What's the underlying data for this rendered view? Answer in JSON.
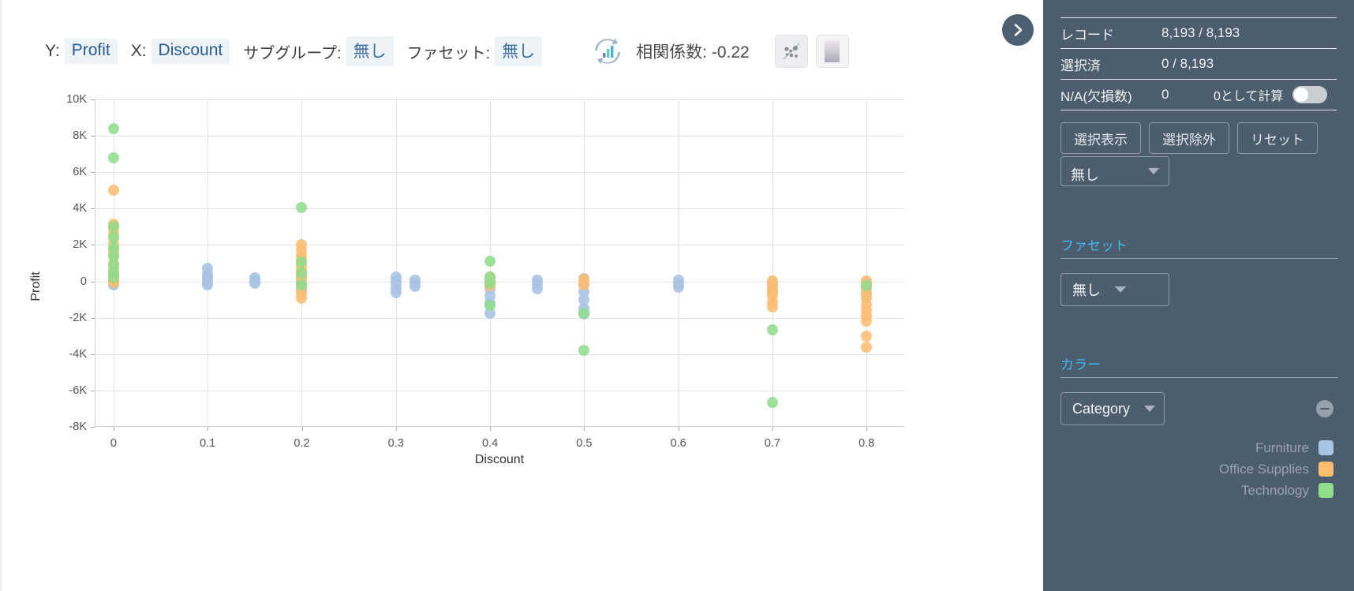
{
  "toolbar": {
    "y_label": "Y:",
    "y_value": "Profit",
    "x_label": "X:",
    "x_value": "Discount",
    "subgroup_label": "サブグループ:",
    "subgroup_value": "無し",
    "facet_label": "ファセット:",
    "facet_value": "無し",
    "correlation_text": "相関係数: -0.22",
    "refresh_icon": "refresh-chart-icon",
    "scatter_mode_icon": "scatter-plot-icon",
    "density_mode_icon": "density-gradient-icon",
    "collapse_icon": "chevron-right-icon"
  },
  "panel": {
    "stats": [
      {
        "key": "レコード",
        "value": "8,193 / 8,193"
      },
      {
        "key": "選択済",
        "value": "0 / 8,193"
      }
    ],
    "na_row": {
      "key": "N/A(欠損数)",
      "count": "0",
      "toggle_label": "0として計算",
      "toggle_on": false
    },
    "buttons": [
      {
        "label": "選択表示",
        "name": "show-selection-button"
      },
      {
        "label": "選択除外",
        "name": "exclude-selection-button"
      },
      {
        "label": "リセット",
        "name": "reset-button"
      }
    ],
    "clipped_select_value": "無し",
    "facet_section": {
      "title": "ファセット",
      "value": "無し"
    },
    "color_section": {
      "title": "カラー",
      "value": "Category",
      "remove_icon": "remove-circle-icon"
    },
    "legend": [
      {
        "label": "Furniture",
        "color": "#a9c3e4"
      },
      {
        "label": "Office Supplies",
        "color": "#fbbd72"
      },
      {
        "label": "Technology",
        "color": "#90dd8c"
      }
    ]
  },
  "chart_data": {
    "type": "scatter",
    "title": "",
    "xlabel": "Discount",
    "ylabel": "Profit",
    "xlim": [
      -0.02,
      0.84
    ],
    "ylim": [
      -8000,
      10000
    ],
    "xticks": [
      "0",
      "0.1",
      "0.2",
      "0.3",
      "0.4",
      "0.5",
      "0.6",
      "0.7",
      "0.8"
    ],
    "xtick_values": [
      0,
      0.1,
      0.2,
      0.3,
      0.4,
      0.5,
      0.6,
      0.7,
      0.8
    ],
    "yticks": [
      "10K",
      "8K",
      "6K",
      "4K",
      "2K",
      "0",
      "-2K",
      "-4K",
      "-6K",
      "-8K"
    ],
    "ytick_values": [
      10000,
      8000,
      6000,
      4000,
      2000,
      0,
      -2000,
      -4000,
      -6000,
      -8000
    ],
    "grid": true,
    "legend_position": "right-panel",
    "correlation": -0.22,
    "color_by": "Category",
    "series": [
      {
        "name": "Furniture",
        "color": "#a9c3e4",
        "points": [
          [
            0,
            500
          ],
          [
            0,
            300
          ],
          [
            0,
            150
          ],
          [
            0,
            60
          ],
          [
            0,
            -40
          ],
          [
            0,
            -120
          ],
          [
            0,
            20
          ],
          [
            0,
            420
          ],
          [
            0,
            240
          ],
          [
            0,
            -200
          ],
          [
            0,
            380
          ],
          [
            0,
            100
          ],
          [
            0.1,
            700
          ],
          [
            0.1,
            400
          ],
          [
            0.1,
            150
          ],
          [
            0.1,
            -50
          ],
          [
            0.1,
            -180
          ],
          [
            0.1,
            260
          ],
          [
            0.15,
            180
          ],
          [
            0.15,
            20
          ],
          [
            0.15,
            -120
          ],
          [
            0.2,
            300
          ],
          [
            0.2,
            60
          ],
          [
            0.2,
            -160
          ],
          [
            0.2,
            -320
          ],
          [
            0.2,
            -500
          ],
          [
            0.2,
            150
          ],
          [
            0.3,
            220
          ],
          [
            0.3,
            30
          ],
          [
            0.3,
            -150
          ],
          [
            0.3,
            -400
          ],
          [
            0.3,
            -620
          ],
          [
            0.32,
            60
          ],
          [
            0.32,
            -120
          ],
          [
            0.32,
            -300
          ],
          [
            0.4,
            200
          ],
          [
            0.4,
            -100
          ],
          [
            0.4,
            -400
          ],
          [
            0.4,
            -800
          ],
          [
            0.4,
            -1200
          ],
          [
            0.4,
            -1750
          ],
          [
            0.45,
            60
          ],
          [
            0.45,
            -160
          ],
          [
            0.45,
            -420
          ],
          [
            0.5,
            150
          ],
          [
            0.5,
            -200
          ],
          [
            0.5,
            -600
          ],
          [
            0.5,
            -1000
          ],
          [
            0.5,
            -1500
          ],
          [
            0.5,
            -1800
          ],
          [
            0.6,
            60
          ],
          [
            0.6,
            -140
          ],
          [
            0.6,
            -330
          ],
          [
            0.7,
            -100
          ],
          [
            0.7,
            -300
          ],
          [
            0.7,
            -550
          ],
          [
            0.8,
            -120
          ],
          [
            0.8,
            -380
          ],
          [
            0.8,
            -700
          ]
        ]
      },
      {
        "name": "Office Supplies",
        "color": "#fbbd72",
        "points": [
          [
            0,
            5000
          ],
          [
            0,
            3150
          ],
          [
            0,
            2600
          ],
          [
            0,
            2050
          ],
          [
            0,
            1450
          ],
          [
            0,
            1000
          ],
          [
            0,
            700
          ],
          [
            0,
            420
          ],
          [
            0,
            200
          ],
          [
            0,
            60
          ],
          [
            0,
            -80
          ],
          [
            0,
            2900
          ],
          [
            0,
            1700
          ],
          [
            0.2,
            2020
          ],
          [
            0.2,
            1700
          ],
          [
            0.2,
            1400
          ],
          [
            0.2,
            1150
          ],
          [
            0.2,
            900
          ],
          [
            0.2,
            650
          ],
          [
            0.2,
            380
          ],
          [
            0.2,
            120
          ],
          [
            0.2,
            -300
          ],
          [
            0.2,
            -650
          ],
          [
            0.2,
            -950
          ],
          [
            0.4,
            260
          ],
          [
            0.4,
            40
          ],
          [
            0.4,
            -220
          ],
          [
            0.5,
            120
          ],
          [
            0.5,
            -180
          ],
          [
            0.7,
            40
          ],
          [
            0.7,
            -220
          ],
          [
            0.7,
            -520
          ],
          [
            0.7,
            -800
          ],
          [
            0.7,
            -1150
          ],
          [
            0.7,
            -1420
          ],
          [
            0.8,
            10
          ],
          [
            0.8,
            -300
          ],
          [
            0.8,
            -620
          ],
          [
            0.8,
            -950
          ],
          [
            0.8,
            -1280
          ],
          [
            0.8,
            -1600
          ],
          [
            0.8,
            -1900
          ],
          [
            0.8,
            -2200
          ],
          [
            0.8,
            -3000
          ],
          [
            0.8,
            -3600
          ]
        ]
      },
      {
        "name": "Technology",
        "color": "#90dd8c",
        "points": [
          [
            0,
            8400
          ],
          [
            0,
            6800
          ],
          [
            0,
            3000
          ],
          [
            0,
            2400
          ],
          [
            0,
            1850
          ],
          [
            0,
            1350
          ],
          [
            0,
            900
          ],
          [
            0,
            520
          ],
          [
            0,
            180
          ],
          [
            0.2,
            4050
          ],
          [
            0.2,
            1050
          ],
          [
            0.2,
            450
          ],
          [
            0.2,
            -180
          ],
          [
            0.4,
            1100
          ],
          [
            0.4,
            220
          ],
          [
            0.4,
            -100
          ],
          [
            0.4,
            -1300
          ],
          [
            0.5,
            -1750
          ],
          [
            0.5,
            -3800
          ],
          [
            0.7,
            -2650
          ],
          [
            0.7,
            -6650
          ],
          [
            0.8,
            -250
          ]
        ]
      }
    ]
  }
}
